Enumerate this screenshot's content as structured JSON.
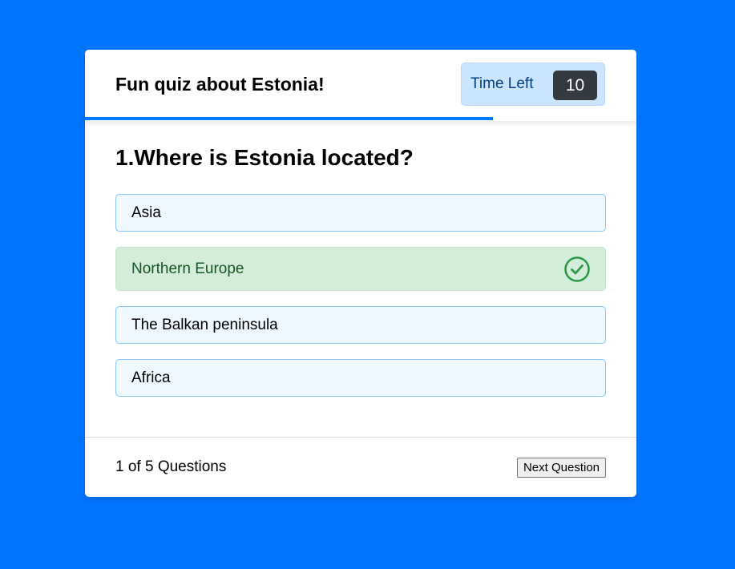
{
  "quiz": {
    "title": "Fun quiz about Estonia!",
    "timer": {
      "label": "Time Left",
      "seconds": "10"
    },
    "time_progress": 0.74,
    "question": {
      "number": "1",
      "text": "1.Where is Estonia located?"
    },
    "options": [
      {
        "label": "Asia",
        "state": "default"
      },
      {
        "label": "Northern Europe",
        "state": "correct",
        "icon": "check-circle-icon"
      },
      {
        "label": "The Balkan peninsula",
        "state": "default"
      },
      {
        "label": "Africa",
        "state": "default"
      }
    ],
    "footer": {
      "counter": "1 of 5 Questions",
      "next_label": "Next Question"
    }
  },
  "colors": {
    "background": "#0075ff",
    "accent": "#007bff",
    "correct_bg": "#d4edda",
    "correct_text": "#155724",
    "option_bg": "#f0f8ff",
    "option_border": "#84c5fe",
    "timer_bg": "#cce5ff",
    "timer_badge": "#343a40"
  }
}
